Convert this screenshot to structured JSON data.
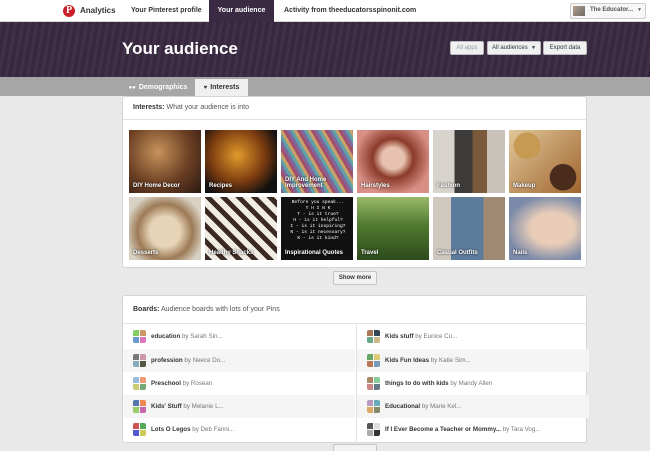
{
  "nav": {
    "brand": "Analytics",
    "tabs": [
      "Your Pinterest profile",
      "Your audience",
      "Activity from theeducatorsspinonit.com"
    ],
    "account_name": "The Educator..."
  },
  "hero": {
    "title": "Your audience",
    "all_apps": "All apps",
    "all_audiences": "All audiences",
    "export": "Export data"
  },
  "subtabs": {
    "demographics": "Demographics",
    "interests": "Interests"
  },
  "interests": {
    "heading": "Interests:",
    "subheading": "What your audience is into",
    "tiles": [
      "DIY Home Decor",
      "Recipes",
      "DIY And Home Improvement",
      "Hairstyles",
      "Fashion",
      "Makeup",
      "Desserts",
      "Healthy Snacks",
      "Inspirational Quotes",
      "Travel",
      "Casual Outfits",
      "Nails"
    ],
    "quote_lines": [
      "Before you speak...",
      "T H I N K",
      "T - is it true?",
      "H - is it helpful?",
      "I - is it inspiring?",
      "N - is it necessary?",
      "K - is it kind?"
    ],
    "show_more": "Show more"
  },
  "boards": {
    "heading": "Boards:",
    "subheading": "Audience boards with lots of your Pins",
    "rows": [
      {
        "name": "education",
        "by": "by Sarah Sin..."
      },
      {
        "name": "Kids stuff",
        "by": "by Eunice Cu..."
      },
      {
        "name": "profession",
        "by": "by Neece Do..."
      },
      {
        "name": "Kids Fun Ideas",
        "by": "by Katie Sim..."
      },
      {
        "name": "Preschool",
        "by": "by Rosean"
      },
      {
        "name": "things to do with kids",
        "by": "by Mandy Allen"
      },
      {
        "name": "Kids' Stuff",
        "by": "by Melanie L..."
      },
      {
        "name": "Educational",
        "by": "by Marie Kel..."
      },
      {
        "name": "Lots O Legos",
        "by": "by Deb Fanni..."
      },
      {
        "name": "If I Ever Become a Teacher or Mommy...",
        "by": "by Tara Vog..."
      }
    ]
  },
  "colors": {
    "hero": "#3a2a43",
    "brand": "#cb2027",
    "active_tab": "#3b2a44"
  }
}
